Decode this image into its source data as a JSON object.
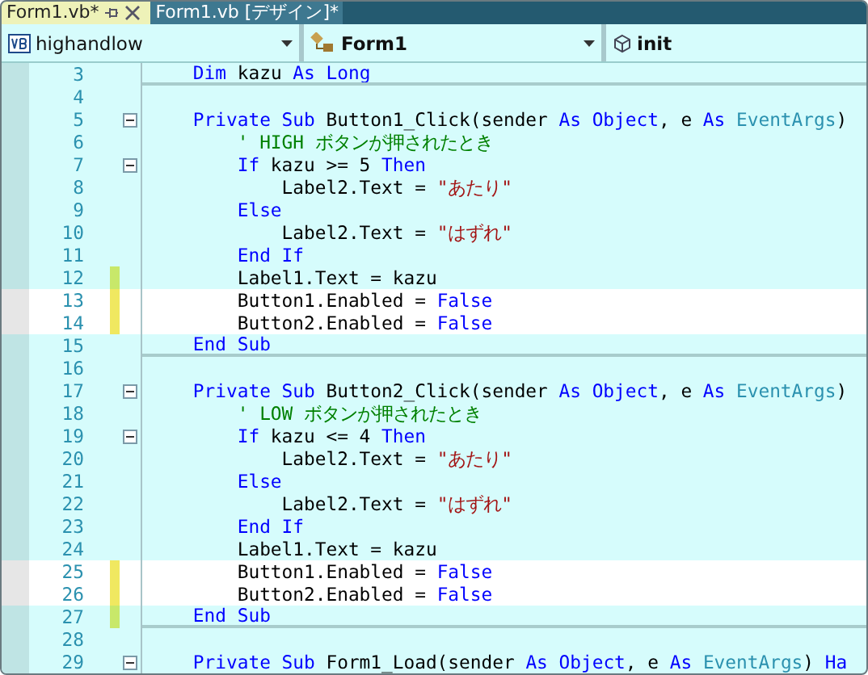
{
  "tabs": [
    {
      "label": "Form1.vb*",
      "selected": true,
      "pinnable": true
    },
    {
      "label": "Form1.vb [デザイン]*",
      "selected": false,
      "pinnable": false
    }
  ],
  "navigation": [
    {
      "kind": "project",
      "label": "highandlow"
    },
    {
      "kind": "class",
      "label": "Form1"
    },
    {
      "kind": "member",
      "label": "init"
    }
  ],
  "lines": [
    {
      "number": "3",
      "foldable": false,
      "highlighted": false,
      "modified": false,
      "separator": true,
      "tokens": [
        {
          "kind": "keyword",
          "text": "    Dim"
        },
        {
          "kind": "plain",
          "text": " kazu "
        },
        {
          "kind": "keyword",
          "text": "As Long"
        }
      ]
    },
    {
      "number": "4",
      "foldable": false,
      "highlighted": false,
      "modified": false,
      "separator": false
    },
    {
      "number": "5",
      "foldable": true,
      "highlighted": false,
      "modified": false,
      "separator": false,
      "tokens": [
        {
          "kind": "keyword",
          "text": "    Private Sub"
        },
        {
          "kind": "plain",
          "text": " Button1_Click(sender "
        },
        {
          "kind": "keyword",
          "text": "As Object"
        },
        {
          "kind": "plain",
          "text": ", e "
        },
        {
          "kind": "keyword",
          "text": "As "
        },
        {
          "kind": "type",
          "text": "EventArgs"
        },
        {
          "kind": "plain",
          "text": ")"
        }
      ]
    },
    {
      "number": "6",
      "foldable": false,
      "highlighted": false,
      "modified": false,
      "separator": false,
      "tokens": [
        {
          "kind": "comment",
          "text": "        ' HIGH ボタンが押されたとき"
        }
      ]
    },
    {
      "number": "7",
      "foldable": true,
      "highlighted": false,
      "modified": false,
      "separator": false,
      "tokens": [
        {
          "kind": "keyword",
          "text": "        If"
        },
        {
          "kind": "plain",
          "text": " kazu >= 5 "
        },
        {
          "kind": "keyword",
          "text": "Then"
        }
      ]
    },
    {
      "number": "8",
      "foldable": false,
      "highlighted": false,
      "modified": false,
      "separator": false,
      "tokens": [
        {
          "kind": "plain",
          "text": "            Label2.Text = "
        },
        {
          "kind": "string",
          "text": "\"あたり\""
        }
      ]
    },
    {
      "number": "9",
      "foldable": false,
      "highlighted": false,
      "modified": false,
      "separator": false,
      "tokens": [
        {
          "kind": "keyword",
          "text": "        Else"
        }
      ]
    },
    {
      "number": "10",
      "foldable": false,
      "highlighted": false,
      "modified": false,
      "separator": false,
      "tokens": [
        {
          "kind": "plain",
          "text": "            Label2.Text = "
        },
        {
          "kind": "string",
          "text": "\"はずれ\""
        }
      ]
    },
    {
      "number": "11",
      "foldable": false,
      "highlighted": false,
      "modified": false,
      "separator": false,
      "tokens": [
        {
          "kind": "keyword",
          "text": "        End If"
        }
      ]
    },
    {
      "number": "12",
      "foldable": false,
      "highlighted": false,
      "modified": true,
      "color": "#c8e86a",
      "separator": false,
      "tokens": [
        {
          "kind": "plain",
          "text": "        Label1.Text = kazu"
        }
      ]
    },
    {
      "number": "13",
      "foldable": false,
      "highlighted": true,
      "modified": true,
      "color": "#f0e860",
      "separator": false,
      "tokens": [
        {
          "kind": "plain",
          "text": "        Button1.Enabled = "
        },
        {
          "kind": "keyword",
          "text": "False"
        }
      ]
    },
    {
      "number": "14",
      "foldable": false,
      "highlighted": true,
      "modified": true,
      "color": "#f0e860",
      "separator": false,
      "tokens": [
        {
          "kind": "plain",
          "text": "        Button2.Enabled = "
        },
        {
          "kind": "keyword",
          "text": "False"
        }
      ]
    },
    {
      "number": "15",
      "foldable": false,
      "highlighted": false,
      "modified": false,
      "separator": true,
      "tokens": [
        {
          "kind": "keyword",
          "text": "    End Sub"
        }
      ]
    },
    {
      "number": "16",
      "foldable": false,
      "highlighted": false,
      "modified": false,
      "separator": false
    },
    {
      "number": "17",
      "foldable": true,
      "highlighted": false,
      "modified": false,
      "separator": false,
      "tokens": [
        {
          "kind": "keyword",
          "text": "    Private Sub"
        },
        {
          "kind": "plain",
          "text": " Button2_Click(sender "
        },
        {
          "kind": "keyword",
          "text": "As Object"
        },
        {
          "kind": "plain",
          "text": ", e "
        },
        {
          "kind": "keyword",
          "text": "As "
        },
        {
          "kind": "type",
          "text": "EventArgs"
        },
        {
          "kind": "plain",
          "text": ")"
        }
      ]
    },
    {
      "number": "18",
      "foldable": false,
      "highlighted": false,
      "modified": false,
      "separator": false,
      "tokens": [
        {
          "kind": "comment",
          "text": "        ' LOW ボタンが押されたとき"
        }
      ]
    },
    {
      "number": "19",
      "foldable": true,
      "highlighted": false,
      "modified": false,
      "separator": false,
      "tokens": [
        {
          "kind": "keyword",
          "text": "        If"
        },
        {
          "kind": "plain",
          "text": " kazu <= 4 "
        },
        {
          "kind": "keyword",
          "text": "Then"
        }
      ]
    },
    {
      "number": "20",
      "foldable": false,
      "highlighted": false,
      "modified": false,
      "separator": false,
      "tokens": [
        {
          "kind": "plain",
          "text": "            Label2.Text = "
        },
        {
          "kind": "string",
          "text": "\"あたり\""
        }
      ]
    },
    {
      "number": "21",
      "foldable": false,
      "highlighted": false,
      "modified": false,
      "separator": false,
      "tokens": [
        {
          "kind": "keyword",
          "text": "        Else"
        }
      ]
    },
    {
      "number": "22",
      "foldable": false,
      "highlighted": false,
      "modified": false,
      "separator": false,
      "tokens": [
        {
          "kind": "plain",
          "text": "            Label2.Text = "
        },
        {
          "kind": "string",
          "text": "\"はずれ\""
        }
      ]
    },
    {
      "number": "23",
      "foldable": false,
      "highlighted": false,
      "modified": false,
      "separator": false,
      "tokens": [
        {
          "kind": "keyword",
          "text": "        End If"
        }
      ]
    },
    {
      "number": "24",
      "foldable": false,
      "highlighted": false,
      "modified": false,
      "separator": false,
      "tokens": [
        {
          "kind": "plain",
          "text": "        Label1.Text = kazu"
        }
      ]
    },
    {
      "number": "25",
      "foldable": false,
      "highlighted": true,
      "modified": true,
      "color": "#f0e860",
      "separator": false,
      "tokens": [
        {
          "kind": "plain",
          "text": "        Button1.Enabled = "
        },
        {
          "kind": "keyword",
          "text": "False"
        }
      ]
    },
    {
      "number": "26",
      "foldable": false,
      "highlighted": true,
      "modified": true,
      "color": "#f0e860",
      "separator": false,
      "tokens": [
        {
          "kind": "plain",
          "text": "        Button2.Enabled = "
        },
        {
          "kind": "keyword",
          "text": "False"
        }
      ]
    },
    {
      "number": "27",
      "foldable": false,
      "highlighted": false,
      "modified": true,
      "color": "#c8e86a",
      "separator": true,
      "tokens": [
        {
          "kind": "keyword",
          "text": "    End Sub"
        }
      ]
    },
    {
      "number": "28",
      "foldable": false,
      "highlighted": false,
      "modified": false,
      "separator": false
    },
    {
      "number": "29",
      "foldable": true,
      "highlighted": false,
      "modified": false,
      "separator": false,
      "tokens": [
        {
          "kind": "keyword",
          "text": "    Private Sub"
        },
        {
          "kind": "plain",
          "text": " Form1_Load(sender "
        },
        {
          "kind": "keyword",
          "text": "As Object"
        },
        {
          "kind": "plain",
          "text": ", e "
        },
        {
          "kind": "keyword",
          "text": "As "
        },
        {
          "kind": "type",
          "text": "EventArgs"
        },
        {
          "kind": "plain",
          "text": ") "
        },
        {
          "kind": "keyword",
          "text": "Ha"
        }
      ]
    }
  ]
}
